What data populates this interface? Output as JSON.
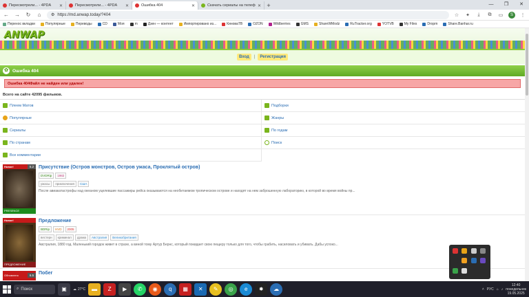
{
  "browser": {
    "tabs": [
      {
        "title": "Пересмотрели... - 4PDA",
        "active": false
      },
      {
        "title": "Пересмотрели... - 4PDA",
        "active": false
      },
      {
        "title": "Ошибка 404",
        "active": true
      },
      {
        "title": "Скачать сериалы на телефон -",
        "active": false
      }
    ],
    "url": "https://md.anwap.today/?404",
    "profile_initial": "S"
  },
  "bookmarks": [
    "Перенос вкладки",
    "Популярные",
    "Переводы",
    "CD",
    "Моя",
    "m",
    "Дзен — контент",
    "Импортировано из...",
    "КиноваTB",
    "OZON",
    "Wildberries",
    "GMS",
    "ShareWModz",
    "RuTracker.org",
    "YOTVB",
    "My Files",
    "Dropm",
    "Share.Banhar.ru"
  ],
  "site": {
    "logo": "ANWAP",
    "auth": {
      "login": "Вход",
      "separator": "|",
      "register": "Регистрация"
    },
    "error_header": "Ошибка 404",
    "error_message": "Ошибка 404Файл не найден или удален!",
    "total": "Всего на сайте 42095 фильмов.",
    "menu": [
      {
        "label": "Плеем Матов",
        "color": "#7ab51d"
      },
      {
        "label": "Подборки",
        "color": "#7ab51d"
      },
      {
        "label": "Популярные",
        "color": "#e8a317"
      },
      {
        "label": "Жанры",
        "color": "#7ab51d"
      },
      {
        "label": "Сериалы",
        "color": "#7ab51d"
      },
      {
        "label": "По годам",
        "color": "#7ab51d"
      },
      {
        "label": "По странам",
        "color": "#7ab51d"
      },
      {
        "label": "Поиск",
        "color": "#7ab51d"
      },
      {
        "label": "Все комментарии",
        "color": "#7ab51d"
      }
    ],
    "movies": [
      {
        "title": "Присутствие (Остров монстров, Остров ужаса, Проклятый остров)",
        "badge": "Новое!",
        "rating": "5.2",
        "poster_caption": "PRESENCE",
        "tags1": [
          "DVDRip",
          "1982"
        ],
        "tags2": [
          "ужасы",
          "приключения",
          "США"
        ],
        "desc": "После авиакатастрофы над океаном уцелевшие пассажиры рейса оказываются на необитаемом тропическом острове и находят на нем заброшенную лабораторию, в которой во время войны пр..."
      },
      {
        "title": "Предложение",
        "badge": "Новое!",
        "rating": "",
        "poster_caption": "ПРЕДЛОЖЕНИЕ",
        "tags1": [
          "BDRip",
          "HVD",
          "2005"
        ],
        "tags2": [
          "вестерн",
          "криминал",
          "драма",
          "Австралия",
          "Великобритания"
        ],
        "desc": "Австралия, 1880 год. Маленький городок живет в страхе, а виной тому Артур Бернс, который покидает свою пещеру только для того, чтобы грабить, насиловать и убивать. Дабы успоко..."
      },
      {
        "title": "Побег",
        "badge": "Обновлено",
        "rating": "6.5"
      }
    ]
  },
  "taskbar": {
    "search_placeholder": "Поиск",
    "weather": "27°C",
    "lang": "РУС",
    "time": "12:40",
    "day": "понедельник",
    "date": "19.05.2025"
  }
}
